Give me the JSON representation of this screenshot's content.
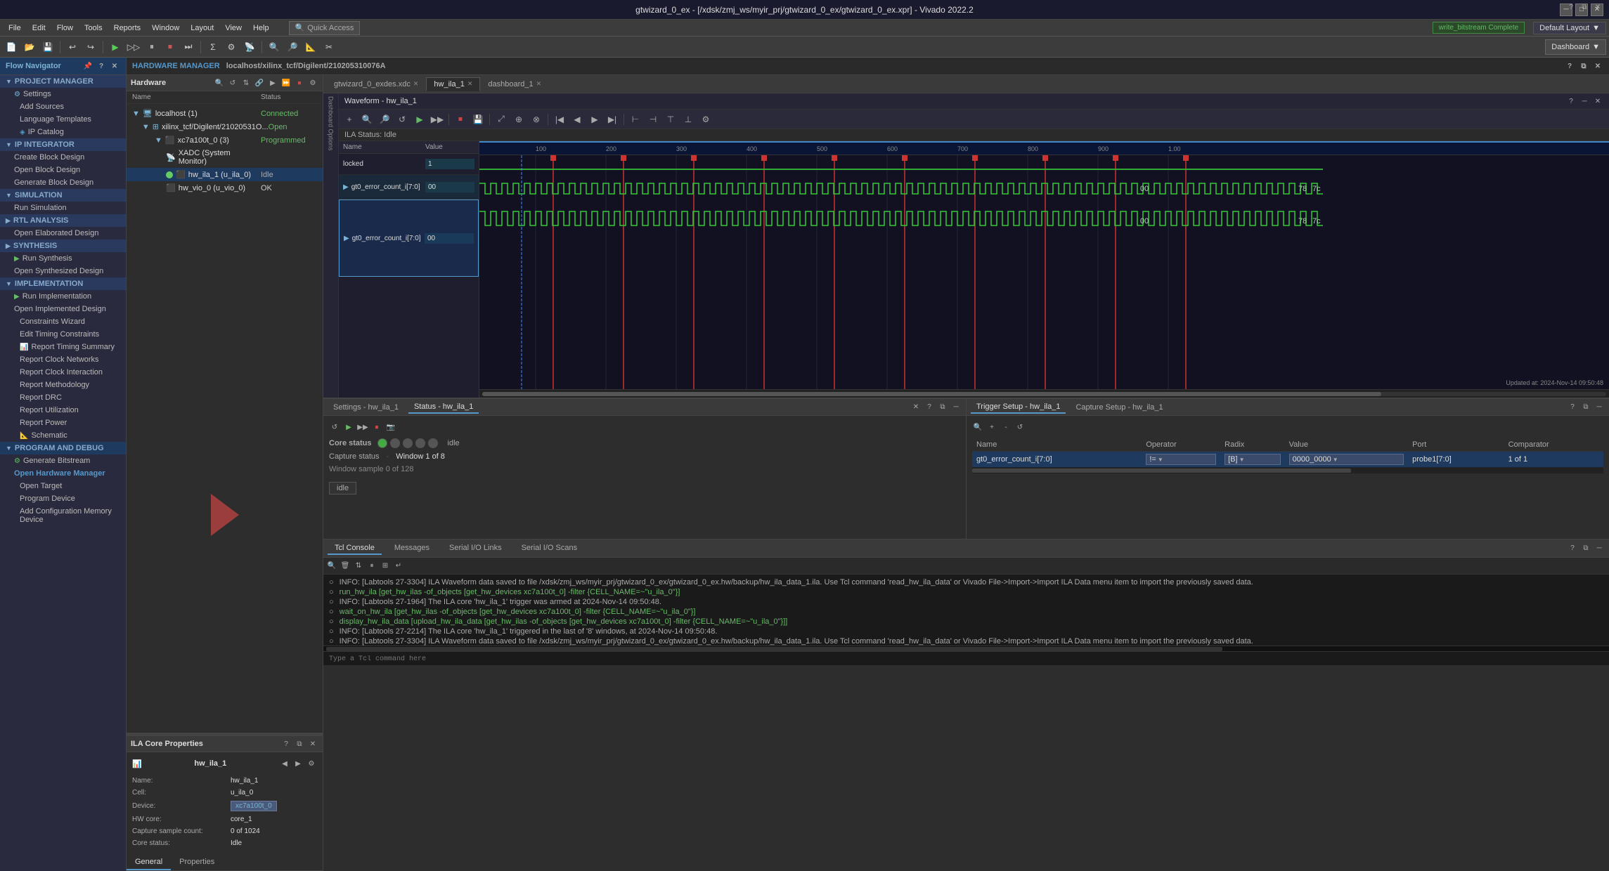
{
  "titleBar": {
    "title": "gtwizard_0_ex - [/xdsk/zmj_ws/myir_prj/gtwizard_0_ex/gtwizard_0_ex.xpr] - Vivado 2022.2",
    "minBtn": "─",
    "maxBtn": "□",
    "closeBtn": "✕"
  },
  "menuBar": {
    "items": [
      "File",
      "Edit",
      "Flow",
      "Tools",
      "Reports",
      "Window",
      "Layout",
      "View",
      "Help"
    ],
    "quickAccess": "Quick Access",
    "writeStatus": "write_bitstream Complete",
    "defaultLayout": "Default Layout"
  },
  "toolbar": {
    "dashboardLabel": "Dashboard",
    "buttons": [
      "⊞",
      "💾",
      "↩",
      "↪",
      "▶",
      "▷",
      "⏸",
      "⏹",
      "⏭",
      "⚙",
      "📊",
      "🔍",
      "🔎",
      "📐",
      "✂"
    ]
  },
  "flowNav": {
    "title": "Flow Navigator",
    "sections": [
      {
        "name": "PROJECT MANAGER",
        "items": [
          {
            "label": "Settings",
            "icon": "⚙",
            "indent": 0
          },
          {
            "label": "Add Sources",
            "indent": 1
          },
          {
            "label": "Language Templates",
            "indent": 1
          },
          {
            "label": "IP Catalog",
            "icon": "📦",
            "indent": 1
          }
        ]
      },
      {
        "name": "IP INTEGRATOR",
        "items": [
          {
            "label": "Create Block Design",
            "indent": 0
          },
          {
            "label": "Open Block Design",
            "indent": 0
          },
          {
            "label": "Generate Block Design",
            "indent": 0
          }
        ]
      },
      {
        "name": "SIMULATION",
        "items": [
          {
            "label": "Run Simulation",
            "indent": 0
          }
        ]
      },
      {
        "name": "RTL ANALYSIS",
        "items": [
          {
            "label": "Open Elaborated Design",
            "indent": 0
          }
        ]
      },
      {
        "name": "SYNTHESIS",
        "items": [
          {
            "label": "Run Synthesis",
            "icon": "▶",
            "indent": 0
          },
          {
            "label": "Open Synthesized Design",
            "indent": 0
          }
        ]
      },
      {
        "name": "IMPLEMENTATION",
        "items": [
          {
            "label": "Run Implementation",
            "icon": "▶",
            "indent": 0
          },
          {
            "label": "Open Implemented Design",
            "indent": 0
          },
          {
            "label": "Constraints Wizard",
            "indent": 1
          },
          {
            "label": "Edit Timing Constraints",
            "indent": 1
          },
          {
            "label": "Report Timing Summary",
            "icon": "📊",
            "indent": 1
          },
          {
            "label": "Report Clock Networks",
            "indent": 1
          },
          {
            "label": "Report Clock Interaction",
            "indent": 1
          },
          {
            "label": "Report Methodology",
            "indent": 1
          },
          {
            "label": "Report DRC",
            "indent": 1
          },
          {
            "label": "Report Utilization",
            "indent": 1
          },
          {
            "label": "Report Power",
            "indent": 1
          },
          {
            "label": "Schematic",
            "icon": "📐",
            "indent": 1
          }
        ]
      },
      {
        "name": "PROGRAM AND DEBUG",
        "items": [
          {
            "label": "Generate Bitstream",
            "indent": 0
          },
          {
            "label": "Open Hardware Manager",
            "indent": 0,
            "bold": true
          },
          {
            "label": "Open Target",
            "indent": 1
          },
          {
            "label": "Program Device",
            "indent": 1
          },
          {
            "label": "Add Configuration Memory Device",
            "indent": 1
          }
        ]
      }
    ]
  },
  "hwManager": {
    "title": "HARDWARE MANAGER",
    "subtitle": "localhost/xilinx_tcf/Digilent/210205310076A"
  },
  "hardware": {
    "title": "Hardware",
    "columns": {
      "name": "Name",
      "status": "Status"
    },
    "tree": [
      {
        "level": 0,
        "icon": "🖥",
        "name": "localhost (1)",
        "status": "Connected",
        "statusClass": "status-connected"
      },
      {
        "level": 1,
        "icon": "🔌",
        "name": "xilinx_tcf/Digilent/21020531O...",
        "status": "Open",
        "statusClass": "status-open"
      },
      {
        "level": 2,
        "icon": "⬛",
        "name": "xc7a100t_0 (3)",
        "status": "Programmed",
        "statusClass": "status-programmed"
      },
      {
        "level": 3,
        "icon": "📡",
        "name": "XADC (System Monitor)",
        "status": "",
        "statusClass": ""
      },
      {
        "level": 3,
        "icon": "📊",
        "name": "hw_ila_1 (u_ila_0)",
        "status": "Idle",
        "statusClass": "status-idle",
        "selected": true,
        "dot": "green"
      },
      {
        "level": 3,
        "icon": "📊",
        "name": "hw_vio_0 (u_vio_0)",
        "status": "OK",
        "statusClass": "status-ok"
      }
    ]
  },
  "ilaProps": {
    "title": "ILA Core Properties",
    "ilaName": "hw_ila_1",
    "properties": [
      {
        "label": "Name:",
        "value": "hw_ila_1"
      },
      {
        "label": "Cell:",
        "value": "u_ila_0"
      },
      {
        "label": "Device:",
        "value": "xc7a100t_0",
        "isBtn": true
      },
      {
        "label": "HW core:",
        "value": "core_1"
      },
      {
        "label": "Capture sample count:",
        "value": "0 of 1024"
      },
      {
        "label": "Core status:",
        "value": "Idle"
      }
    ],
    "tabs": [
      "General",
      "Properties"
    ]
  },
  "waveformTabs": [
    {
      "label": "gtwizard_0_exdes.xdc",
      "active": false
    },
    {
      "label": "hw_ila_1",
      "active": true
    },
    {
      "label": "dashboard_1",
      "active": false
    }
  ],
  "waveform": {
    "title": "Waveform - hw_ila_1",
    "ilaStatus": "ILA Status: Idle",
    "signals": [
      {
        "name": "locked",
        "value": "1"
      },
      {
        "name": "gt0_error_count_i[7:0]",
        "value": "00",
        "expanded": true
      },
      {
        "name": "gt0_error_count_i[7:0]",
        "value": "00",
        "selected": true
      }
    ],
    "nameCol": "Name",
    "valueCol": "Value",
    "timestamp": "Updated at: 2024-Nov-14 09:50:48",
    "timeMarkers": [
      "100",
      "200",
      "300",
      "400",
      "500",
      "600",
      "700",
      "800",
      "900",
      "1.00"
    ]
  },
  "bottomPanels": {
    "left": {
      "tabs": [
        {
          "label": "Settings - hw_ila_1",
          "active": false
        },
        {
          "label": "Status - hw_ila_1",
          "active": true
        }
      ],
      "coreStatus": {
        "label": "Core status",
        "value": "idle"
      },
      "captureStatus": {
        "label": "Capture status",
        "windowLabel": "Window 1 of 8"
      },
      "windowSample": "Window sample 0 of 128",
      "idleBadge": "idle"
    },
    "right": {
      "tabs": [
        {
          "label": "Trigger Setup - hw_ila_1",
          "active": true
        },
        {
          "label": "Capture Setup - hw_ila_1",
          "active": false
        }
      ],
      "columns": [
        "Name",
        "Operator",
        "Radix",
        "Value",
        "Port",
        "Comparator"
      ],
      "rows": [
        {
          "name": "gt0_error_count_i[7:0]",
          "operator": "!=",
          "radix": "[B]",
          "value": "0000_0000",
          "port": "probe1[7:0]",
          "comparator": "1 of 1"
        }
      ]
    }
  },
  "tclConsole": {
    "tabs": [
      "Tcl Console",
      "Messages",
      "Serial I/O Links",
      "Serial I/O Scans"
    ],
    "lines": [
      {
        "type": "info",
        "text": "INFO: [Labtools 27-3304] ILA Waveform data saved to file /xdsk/zmj_ws/myir_prj/gtwizard_0_ex/gtwizard_0_ex.hw/backup/hw_ila_data_1.ila. Use Tcl command 'read_hw_ila_data' or Vivado File->Import->Import ILA Data menu item to import the previously saved data."
      },
      {
        "type": "cmd",
        "text": "run_hw_ila [get_hw_ilas -of_objects [get_hw_devices xc7a100t_0] -filter {CELL_NAME=~\"u_ila_0\"}]"
      },
      {
        "type": "info",
        "text": "INFO: [Labtools 27-1964] The ILA core 'hw_ila_1' trigger was armed at 2024-Nov-14 09:50:48."
      },
      {
        "type": "cmd",
        "text": "wait_on_hw_ila [get_hw_ilas -of_objects [get_hw_devices xc7a100t_0] -filter {CELL_NAME=~\"u_ila_0\"}]"
      },
      {
        "type": "cmd",
        "text": "display_hw_ila_data [upload_hw_ila_data [get_hw_ilas -of_objects [get_hw_devices xc7a100t_0] -filter {CELL_NAME=~\"u_ila_0\"}]]"
      },
      {
        "type": "info",
        "text": "INFO: [Labtools 27-2214] The ILA core 'hw_ila_1' triggered in the last of '8' windows, at 2024-Nov-14 09:50:48."
      },
      {
        "type": "info",
        "text": "INFO: [Labtools 27-3304] ILA Waveform data saved to file /xdsk/zmj_ws/myir_prj/gtwizard_0_ex/gtwizard_0_ex.hw/backup/hw_ila_data_1.ila. Use Tcl command 'read_hw_ila_data' or Vivado File->Import->Import ILA Data menu item to import the previously saved data."
      }
    ],
    "inputPlaceholder": "Type a Tcl command here"
  }
}
